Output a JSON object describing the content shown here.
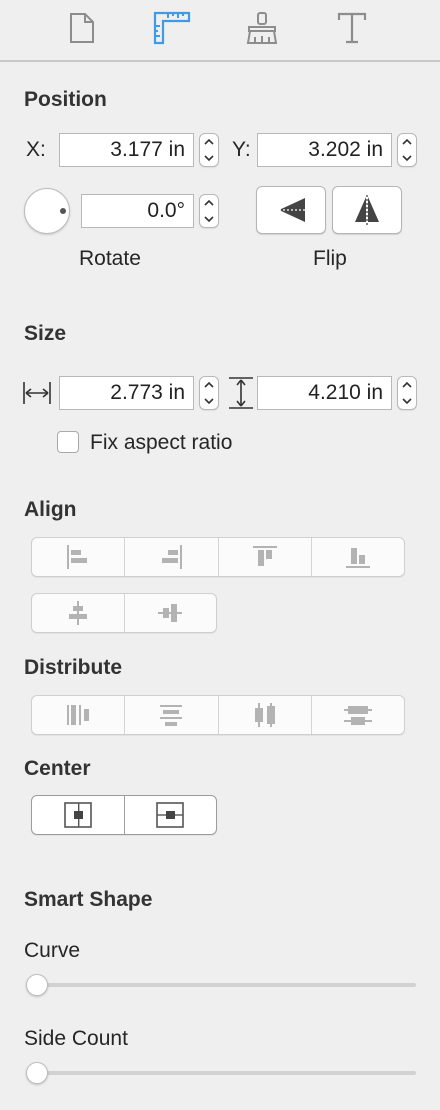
{
  "toolbar": {
    "tabs": [
      {
        "icon": "document-icon"
      },
      {
        "icon": "ruler-icon",
        "active": true
      },
      {
        "icon": "brush-icon"
      },
      {
        "icon": "text-icon"
      }
    ],
    "accent": "#3d9be9"
  },
  "position": {
    "heading": "Position",
    "x_label": "X:",
    "x_value": "3.177 in",
    "y_label": "Y:",
    "y_value": "3.202 in",
    "rotation_value": "0.0°",
    "rotate_label": "Rotate",
    "flip_label": "Flip"
  },
  "size": {
    "heading": "Size",
    "width_value": "2.773 in",
    "height_value": "4.210 in",
    "fix_aspect_label": "Fix aspect ratio",
    "fix_aspect_checked": false
  },
  "align": {
    "heading": "Align"
  },
  "distribute": {
    "heading": "Distribute"
  },
  "center": {
    "heading": "Center"
  },
  "smart_shape": {
    "heading": "Smart Shape",
    "curve_label": "Curve",
    "curve_value": 0,
    "side_count_label": "Side Count",
    "side_count_value": 0
  }
}
